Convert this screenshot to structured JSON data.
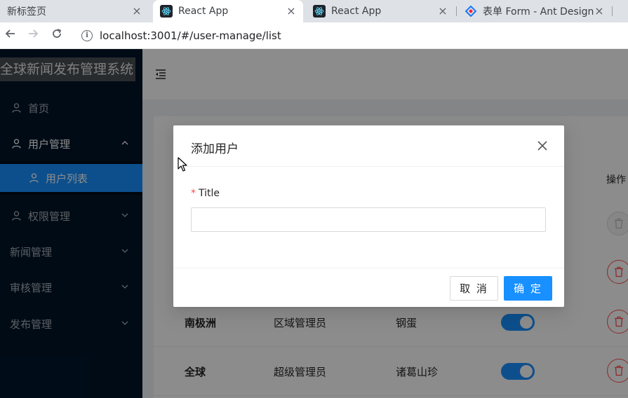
{
  "browser": {
    "tabs": [
      {
        "title": "新标签页",
        "favicon": "none",
        "active": false
      },
      {
        "title": "React App",
        "favicon": "react-icon",
        "active": true
      },
      {
        "title": "React App",
        "favicon": "react-icon",
        "active": false
      },
      {
        "title": "表单 Form - Ant Design",
        "favicon": "ant-design-icon",
        "active": false
      }
    ],
    "close_glyph": "×",
    "url_host": "localhost:3001",
    "url_path": "/#/user-manage/list"
  },
  "sidebar": {
    "logo": "全球新闻发布管理系统",
    "items": [
      {
        "label": "首页",
        "icon": "user-icon",
        "arrow": ""
      },
      {
        "label": "用户管理",
        "icon": "user-icon",
        "arrow": "up"
      },
      {
        "label": "用户列表",
        "icon": "user-icon",
        "arrow": ""
      },
      {
        "label": "权限管理",
        "icon": "user-icon",
        "arrow": "down"
      },
      {
        "label": "新闻管理",
        "icon": "",
        "arrow": "down"
      },
      {
        "label": "审核管理",
        "icon": "",
        "arrow": "down"
      },
      {
        "label": "发布管理",
        "icon": "",
        "arrow": "down"
      }
    ]
  },
  "table": {
    "ops_header": "操作",
    "rows": [
      {
        "region": "南极洲",
        "role": "区域管理员",
        "username": "钢蛋",
        "enabled": true
      },
      {
        "region": "全球",
        "role": "超级管理员",
        "username": "诸葛山珍",
        "enabled": true
      }
    ]
  },
  "modal": {
    "title": "添加用户",
    "field_label": "Title",
    "required_mark": "*",
    "field_value": "",
    "field_placeholder": "",
    "cancel_label": "取 消",
    "ok_label": "确 定"
  },
  "colors": {
    "primary": "#1890ff",
    "danger": "#ff4d4f",
    "sider": "#001529"
  }
}
